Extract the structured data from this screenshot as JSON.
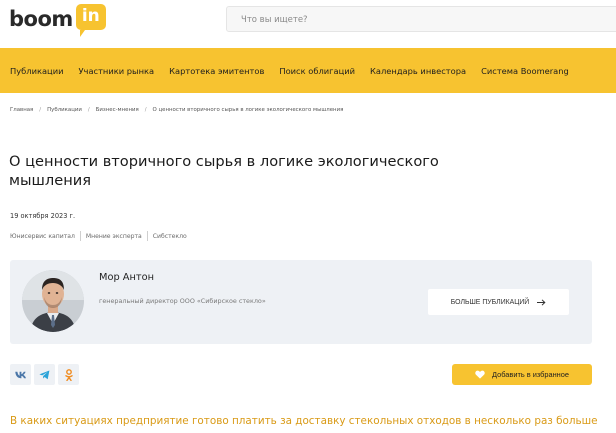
{
  "header": {
    "logo_word": "boom",
    "logo_badge": "in",
    "search_placeholder": "Что вы ищете?"
  },
  "nav": {
    "items": [
      "Публикации",
      "Участники рынка",
      "Картотека эмитентов",
      "Поиск облигаций",
      "Календарь инвестора",
      "Система Boomerang"
    ]
  },
  "breadcrumb": [
    "Главная",
    "Публикации",
    "Бизнес-мнения",
    "О ценности вторичного сырья в логике экологического мышления"
  ],
  "article": {
    "title": "О ценности вторичного сырья в логике экологического мышления",
    "date": "19 октября 2023 г.",
    "tags": [
      "Юнисервис капитал",
      "Мнение эксперта",
      "Сибстекло"
    ],
    "lead": "В каких ситуациях предприятие готово платить за доставку стекольных отходов в несколько раз больше"
  },
  "author": {
    "name": "Мор Антон",
    "role": "генеральный директор ООО «Сибирское стекло»",
    "more_label": "БОЛЬШЕ ПУБЛИКАЦИЙ"
  },
  "share": {
    "icons": [
      "vk-icon",
      "telegram-icon",
      "odnoklassniki-icon"
    ],
    "favorite_label": "Добавить в избранное"
  },
  "colors": {
    "accent": "#f7c330",
    "card_bg": "#eef1f5",
    "lead_text": "#d99a16",
    "vk": "#4a76a8",
    "telegram": "#2aa3d8",
    "ok": "#f08a1c"
  }
}
